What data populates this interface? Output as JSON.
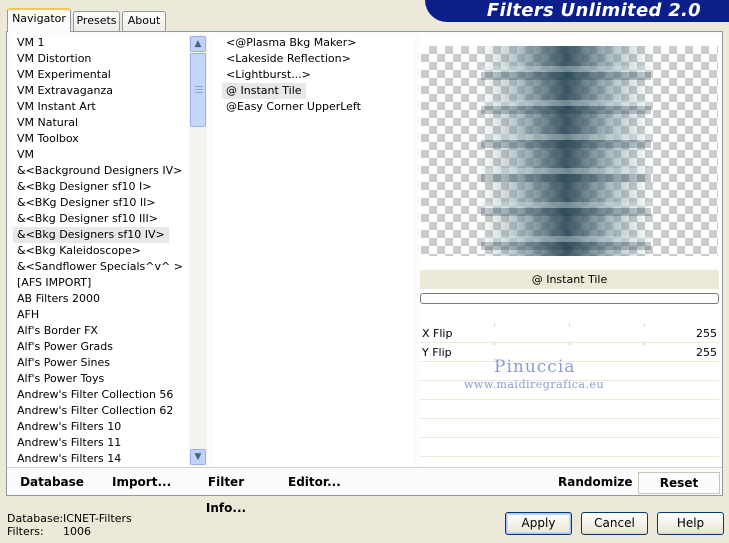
{
  "tabs": [
    {
      "label": "Navigator",
      "active": true
    },
    {
      "label": "Presets",
      "active": false
    },
    {
      "label": "About",
      "active": false
    }
  ],
  "banner_title": "Filters Unlimited 2.0",
  "categories": [
    "VM 1",
    "VM Distortion",
    "VM Experimental",
    "VM Extravaganza",
    "VM Instant Art",
    "VM Natural",
    "VM Toolbox",
    "VM",
    "&<Background Designers IV>",
    "&<Bkg Designer sf10 I>",
    "&<BKg Designer sf10 II>",
    "&<Bkg Designer sf10 III>",
    "&<Bkg Designers sf10 IV>",
    "&<Bkg Kaleidoscope>",
    "&<Sandflower Specials^v^ >",
    "[AFS IMPORT]",
    "AB Filters 2000",
    "AFH",
    "Alf's Border FX",
    "Alf's Power Grads",
    "Alf's Power Sines",
    "Alf's Power Toys",
    "Andrew's Filter Collection 56",
    "Andrew's Filter Collection 62",
    "Andrew's Filters 10",
    "Andrew's Filters 11",
    "Andrew's Filters 14"
  ],
  "selected_category_index": 12,
  "filters": [
    "<@Plasma Bkg Maker>",
    "<Lakeside Reflection>",
    "<Lightburst...>",
    "@ Instant Tile",
    "@Easy Corner UpperLeft"
  ],
  "selected_filter_index": 3,
  "filter_name": "@ Instant Tile",
  "progress": 0,
  "params": [
    {
      "label": "X Flip",
      "value": "255"
    },
    {
      "label": "Y Flip",
      "value": "255"
    }
  ],
  "watermark": {
    "name": "Pinuccia",
    "url": "www.maidiregrafica.eu"
  },
  "toolbar": {
    "database": "Database",
    "import": "Import...",
    "filter_info": "Filter Info...",
    "editor": "Editor...",
    "randomize": "Randomize",
    "reset": "Reset"
  },
  "footer": {
    "database_label": "Database:",
    "database_value": "ICNET-Filters",
    "filters_label": "Filters:",
    "filters_value": "1006"
  },
  "buttons": {
    "apply": "Apply",
    "cancel": "Cancel",
    "help": "Help"
  },
  "colors": {
    "banner": "#0a1f8a",
    "window_bg": "#ece9d8",
    "watermark": "#8a9bd4"
  }
}
